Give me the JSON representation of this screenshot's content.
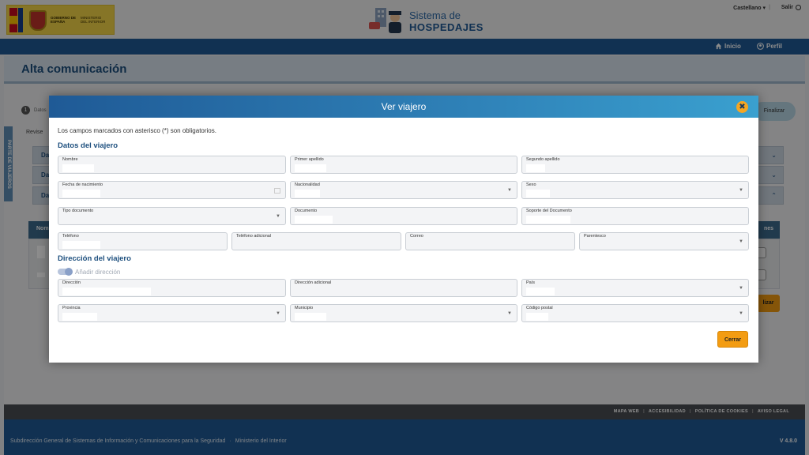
{
  "header": {
    "logo_line1": "GOBIERNO DE ESPAÑA",
    "logo_line2": "MINISTERIO DEL INTERIOR",
    "system_title_line1": "Sistema de",
    "system_title_line2": "HOSPEDAJES",
    "language": "Castellano ▾",
    "separator": "|",
    "logout": "Salir"
  },
  "nav": {
    "home": "Inicio",
    "profile": "Perfil"
  },
  "page": {
    "title": "Alta comunicación",
    "step_number": "1",
    "step_label": "Datos",
    "final_step": "Finalizar",
    "revise_text": "Revise",
    "side_tab": "PARTE DE VIAJEROS",
    "accordions": [
      "Dat",
      "Dat",
      "Dat"
    ],
    "table_header_left": "Nom",
    "table_header_right": "nes",
    "finalize_button": "lizar"
  },
  "footer": {
    "links": [
      "MAPA WEB",
      "ACCESIBILIDAD",
      "POLÍTICA DE COOKIES",
      "AVISO LEGAL"
    ],
    "org": "Subdirección General de Sistemas de Información y Comunicaciones para la Seguridad",
    "ministry": "Ministerio del Interior",
    "version": "V 4.8.0",
    "sep": "·",
    "link_sep": "|"
  },
  "modal": {
    "title": "Ver viajero",
    "close_glyph": "✖",
    "required_note": "Los campos marcados con asterisco (*) son obligatorios.",
    "section_traveler": "Datos del viajero",
    "section_address": "Dirección del viajero",
    "add_address_label": "Añadir dirección",
    "add_address_enabled": true,
    "close_button": "Cerrar",
    "fields": {
      "nombre": "Nombre",
      "primer_apellido": "Primer apellido",
      "segundo_apellido": "Segundo apellido",
      "fecha_nacimiento": "Fecha de nacimiento",
      "nacionalidad": "Nacionalidad",
      "sexo": "Sexo",
      "tipo_documento": "Tipo documento",
      "documento": "Documento",
      "soporte_documento": "Soporte del Documento",
      "telefono": "Teléfono",
      "telefono_adicional": "Teléfono adicional",
      "correo": "Correo",
      "parentesco": "Parentesco",
      "direccion": "Dirección",
      "direccion_adicional": "Dirección adicional",
      "pais": "País",
      "provincia": "Provincia",
      "municipio": "Municipio",
      "codigo_postal": "Código postal"
    }
  },
  "colors": {
    "brand_blue": "#1f5a96",
    "accent_orange": "#f39c12",
    "section_title": "#1d4f7e"
  }
}
